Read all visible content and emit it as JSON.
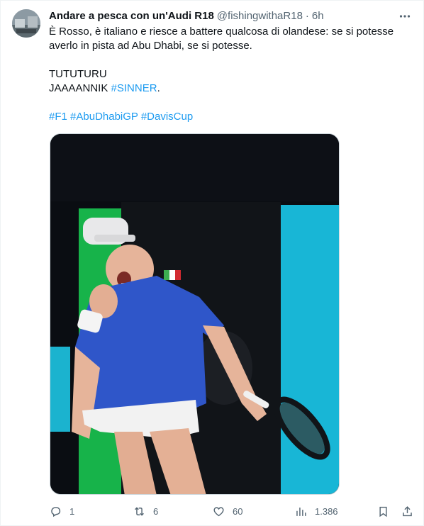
{
  "tweet": {
    "author": {
      "display_name": "Andare a pesca con un'Audi R18",
      "handle": "@fishingwithaR18",
      "time": "6h"
    },
    "menu_icon": "more-dots-icon",
    "text": {
      "line1": "È Rosso, è italiano e riesce a battere qualcosa di olandese: se si potesse",
      "line2": "averlo in pista ad Abu Dhabi, se si potesse.",
      "line3": "TUTUTURU",
      "line4_prefix": "JAAAANNIK ",
      "line4_link": "#SINNER",
      "line4_suffix": ".",
      "hashtags": [
        "#F1",
        "#AbuDhabiGP",
        "#DavisCup"
      ]
    },
    "media": {
      "kind": "photo",
      "subject": "tennis player celebrating"
    },
    "metrics": {
      "replies": "1",
      "reposts": "6",
      "likes": "60",
      "views": "1.386"
    },
    "icons": {
      "reply": "reply-icon",
      "repost": "repost-icon",
      "like": "heart-icon",
      "views": "views-icon",
      "bookmark": "bookmark-icon",
      "share": "share-icon"
    },
    "colors": {
      "link": "#1d9bf0",
      "secondary_text": "#536471",
      "primary_text": "#0f1419"
    }
  }
}
